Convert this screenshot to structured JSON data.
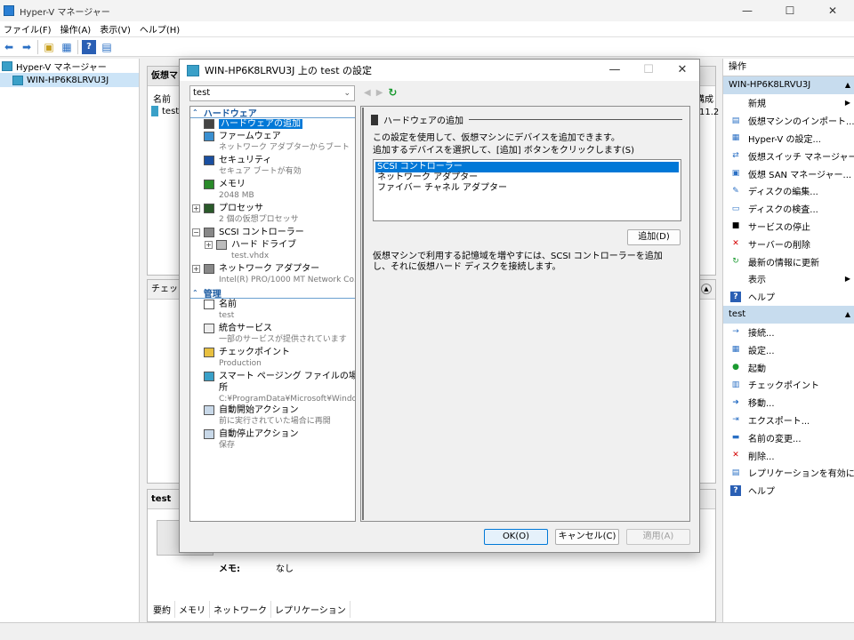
{
  "window": {
    "title": "Hyper-V マネージャー",
    "minimize": "—",
    "maximize": "☐",
    "close": "✕"
  },
  "menu": [
    "ファイル(F)",
    "操作(A)",
    "表示(V)",
    "ヘルプ(H)"
  ],
  "tree": {
    "root": "Hyper-V マネージャー",
    "server": "WIN-HP6K8LRVU3J"
  },
  "center": {
    "vm_panel_title": "仮想マ",
    "col_name": "名前",
    "vm_row": "test",
    "vm_col_right": "構成",
    "vm_col_right_val": "11.2",
    "checkpoint_title": "チェック",
    "details_title": "test",
    "memo_label": "メモ:",
    "memo_value": "なし",
    "tabs": [
      "要約",
      "メモリ",
      "ネットワーク",
      "レプリケーション"
    ]
  },
  "actions": {
    "header": "操作",
    "server_section": "WIN-HP6K8LRVU3J",
    "server_items": [
      {
        "label": "新規",
        "icon": "",
        "arrow": true
      },
      {
        "label": "仮想マシンのインポート...",
        "icon": "import-icon"
      },
      {
        "label": "Hyper-V の設定...",
        "icon": "settings-icon"
      },
      {
        "label": "仮想スイッチ マネージャー...",
        "icon": "switch-icon"
      },
      {
        "label": "仮想 SAN マネージャー...",
        "icon": "san-icon"
      },
      {
        "label": "ディスクの編集...",
        "icon": "disk-edit-icon"
      },
      {
        "label": "ディスクの検査...",
        "icon": "disk-inspect-icon"
      },
      {
        "label": "サービスの停止",
        "icon": "stop-icon"
      },
      {
        "label": "サーバーの削除",
        "icon": "remove-icon"
      },
      {
        "label": "最新の情報に更新",
        "icon": "refresh-icon"
      },
      {
        "label": "表示",
        "icon": "",
        "arrow": true
      },
      {
        "label": "ヘルプ",
        "icon": "help-icon"
      }
    ],
    "vm_section": "test",
    "vm_items": [
      {
        "label": "接続...",
        "icon": "connect-icon"
      },
      {
        "label": "設定...",
        "icon": "settings-icon"
      },
      {
        "label": "起動",
        "icon": "start-icon"
      },
      {
        "label": "チェックポイント",
        "icon": "checkpoint-icon"
      },
      {
        "label": "移動...",
        "icon": "move-icon"
      },
      {
        "label": "エクスポート...",
        "icon": "export-icon"
      },
      {
        "label": "名前の変更...",
        "icon": "rename-icon"
      },
      {
        "label": "削除...",
        "icon": "delete-icon"
      },
      {
        "label": "レプリケーションを有効にす...",
        "icon": "replication-icon"
      },
      {
        "label": "ヘルプ",
        "icon": "help-icon"
      }
    ]
  },
  "dialog": {
    "title": "WIN-HP6K8LRVU3J 上の test の設定",
    "vm_selected": "test",
    "categories": {
      "hardware": "ハードウェア",
      "management": "管理"
    },
    "hardware_items": [
      {
        "label": "ハードウェアの追加",
        "sub": "",
        "selected": true,
        "expand": ""
      },
      {
        "label": "ファームウェア",
        "sub": "ネットワーク アダプターからブート",
        "expand": ""
      },
      {
        "label": "セキュリティ",
        "sub": "セキュア ブートが有効",
        "expand": ""
      },
      {
        "label": "メモリ",
        "sub": "2048 MB",
        "expand": ""
      },
      {
        "label": "プロセッサ",
        "sub": "2 個の仮想プロセッサ",
        "expand": "+"
      },
      {
        "label": "SCSI コントローラー",
        "sub": "",
        "expand": "−"
      },
      {
        "label": "ハード ドライブ",
        "sub": "test.vhdx",
        "expand": "+",
        "indent": true
      },
      {
        "label": "ネットワーク アダプター",
        "sub": "Intel(R) PRO/1000 MT Network Co...",
        "expand": "+"
      }
    ],
    "management_items": [
      {
        "label": "名前",
        "sub": "test"
      },
      {
        "label": "統合サービス",
        "sub": "一部のサービスが提供されています"
      },
      {
        "label": "チェックポイント",
        "sub": "Production"
      },
      {
        "label": "スマート ページング ファイルの場所",
        "sub": "C:¥ProgramData¥Microsoft¥Windo..."
      },
      {
        "label": "自動開始アクション",
        "sub": "前に実行されていた場合に再開"
      },
      {
        "label": "自動停止アクション",
        "sub": "保存"
      }
    ],
    "panel": {
      "heading": "ハードウェアの追加",
      "line1": "この設定を使用して、仮想マシンにデバイスを追加できます。",
      "line2": "追加するデバイスを選択して、[追加] ボタンをクリックします(S)",
      "devices": [
        "SCSI コントローラー",
        "ネットワーク アダプター",
        "ファイバー チャネル アダプター"
      ],
      "selected_device": "SCSI コントローラー",
      "add_button": "追加(D)",
      "description": "仮想マシンで利用する記憶域を増やすには、SCSI コントローラーを追加し、それに仮想ハード ディスクを接続します。"
    },
    "buttons": {
      "ok": "OK(O)",
      "cancel": "キャンセル(C)",
      "apply": "適用(A)"
    }
  }
}
